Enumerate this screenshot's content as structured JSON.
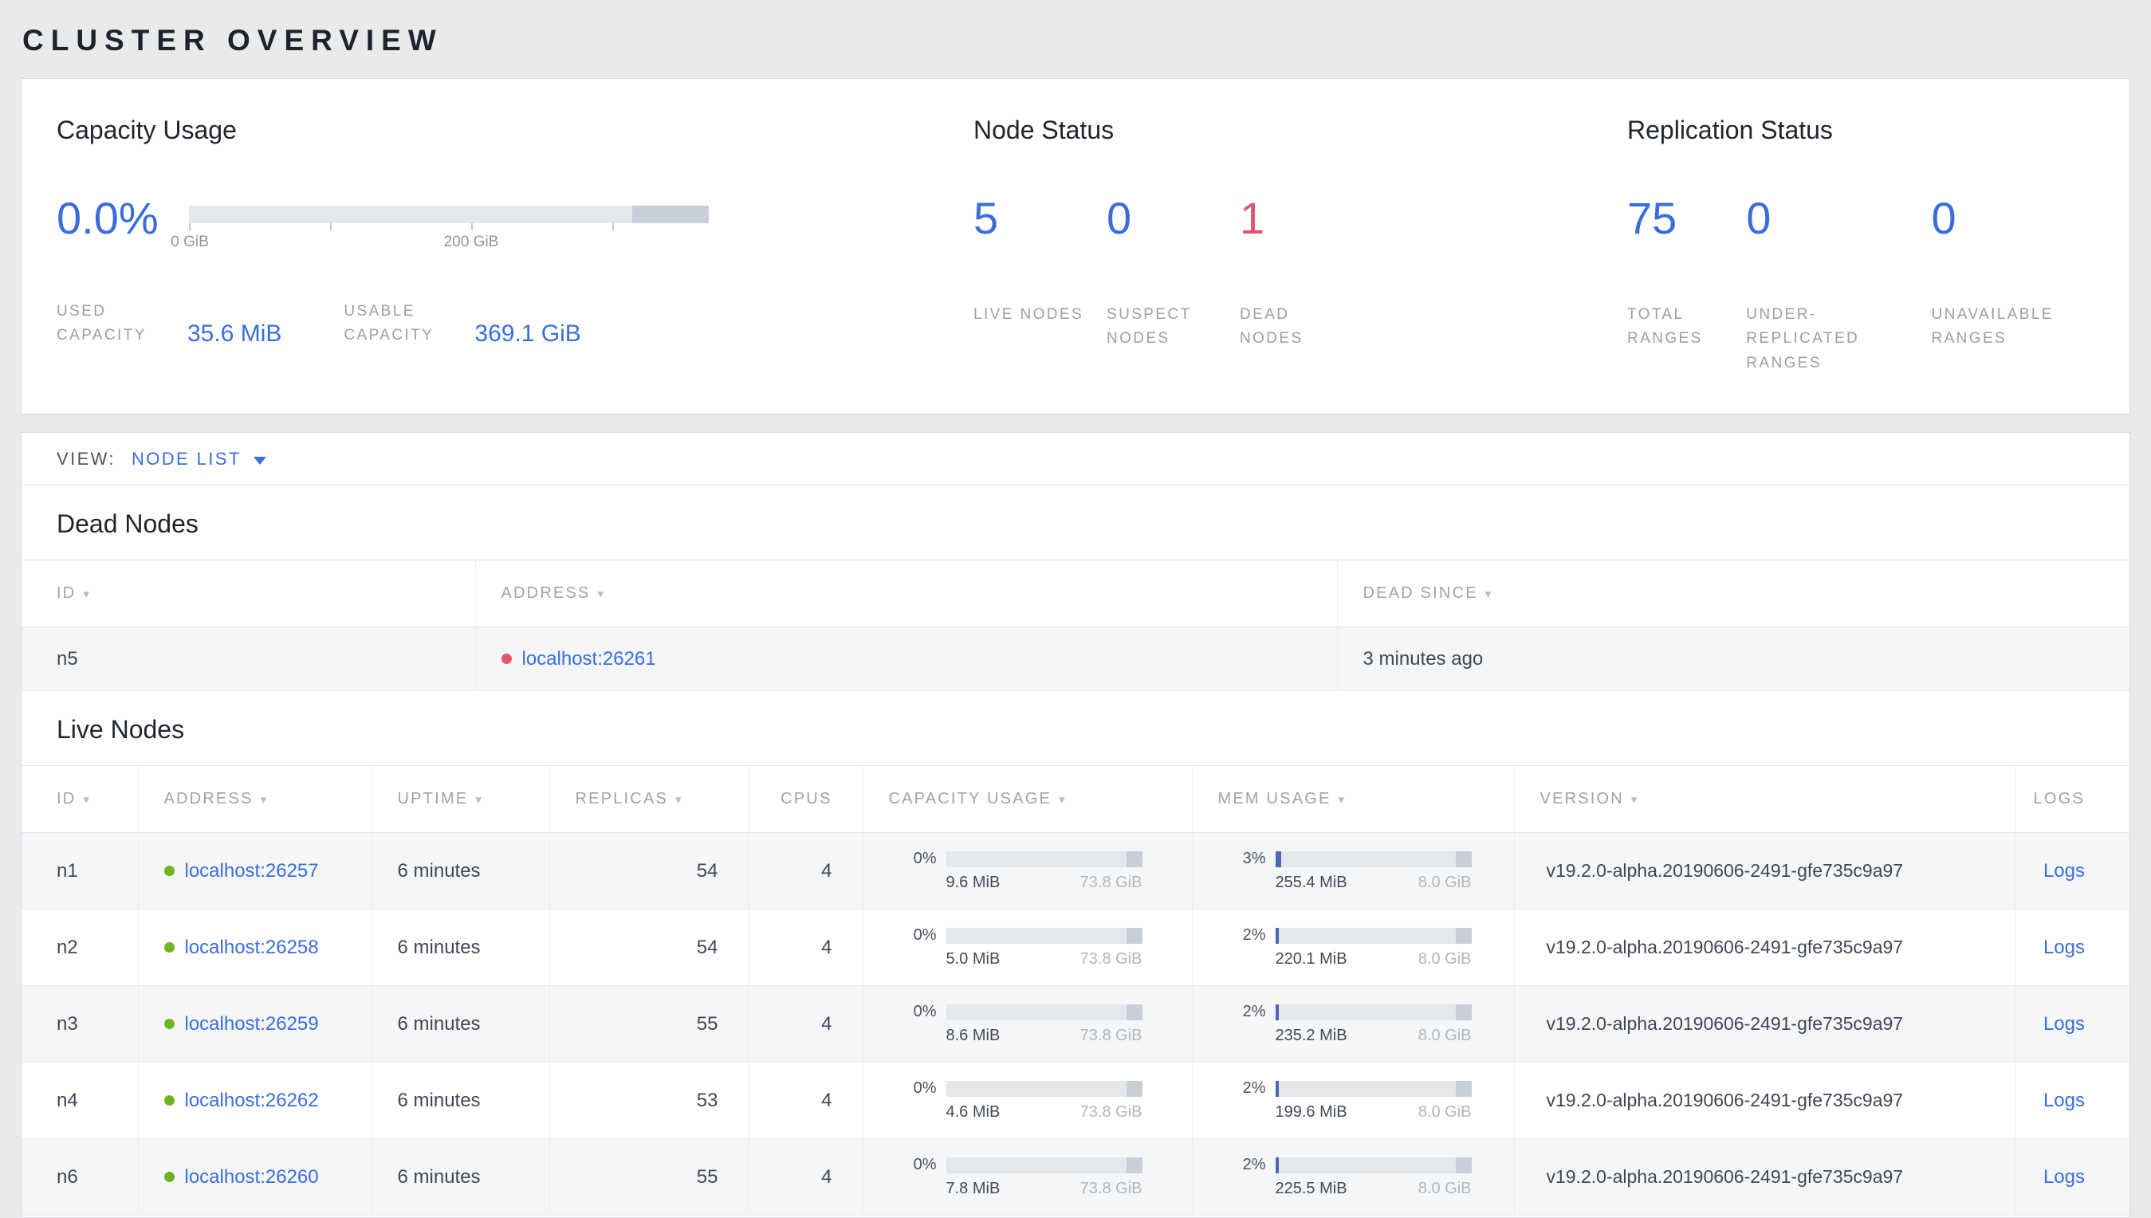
{
  "page_title": "CLUSTER OVERVIEW",
  "colors": {
    "accent_blue": "#3a6ddc",
    "dead_red": "#e2556d",
    "live_green": "#6fb421"
  },
  "summary": {
    "capacity": {
      "title": "Capacity Usage",
      "percent": "0.0%",
      "bar_fill_pct": 0,
      "tick_labels": [
        "0 GiB",
        "200 GiB"
      ],
      "used": {
        "label": "USED CAPACITY",
        "value": "35.6 MiB"
      },
      "usable": {
        "label": "USABLE CAPACITY",
        "value": "369.1 GiB"
      }
    },
    "node_status": {
      "title": "Node Status",
      "live": {
        "value": "5",
        "label": "LIVE NODES"
      },
      "suspect": {
        "value": "0",
        "label": "SUSPECT NODES"
      },
      "dead": {
        "value": "1",
        "label": "DEAD NODES"
      }
    },
    "replication": {
      "title": "Replication Status",
      "total": {
        "value": "75",
        "label": "TOTAL RANGES"
      },
      "under_replicated": {
        "value": "0",
        "label": "UNDER-REPLICATED RANGES"
      },
      "unavailable": {
        "value": "0",
        "label": "UNAVAILABLE RANGES"
      }
    }
  },
  "view": {
    "label": "VIEW:",
    "selected": "NODE LIST"
  },
  "dead_nodes": {
    "title": "Dead Nodes",
    "columns": [
      {
        "label": "ID",
        "sortable": true
      },
      {
        "label": "ADDRESS",
        "sortable": true
      },
      {
        "label": "DEAD SINCE",
        "sortable": true
      }
    ],
    "rows": [
      {
        "id": "n5",
        "address": "localhost:26261",
        "dead_since": "3 minutes ago"
      }
    ]
  },
  "live_nodes": {
    "title": "Live Nodes",
    "columns": [
      {
        "label": "ID",
        "sortable": true
      },
      {
        "label": "ADDRESS",
        "sortable": true
      },
      {
        "label": "UPTIME",
        "sortable": true
      },
      {
        "label": "REPLICAS",
        "sortable": true
      },
      {
        "label": "CPUS",
        "sortable": false
      },
      {
        "label": "CAPACITY USAGE",
        "sortable": true
      },
      {
        "label": "MEM USAGE",
        "sortable": true
      },
      {
        "label": "VERSION",
        "sortable": true
      },
      {
        "label": "LOGS",
        "sortable": false
      }
    ],
    "rows": [
      {
        "id": "n1",
        "address": "localhost:26257",
        "uptime": "6 minutes",
        "replicas": "54",
        "cpus": "4",
        "capacity": {
          "percent": "0%",
          "fill_pct": 0,
          "used": "9.6 MiB",
          "total": "73.8 GiB"
        },
        "memory": {
          "percent": "3%",
          "fill_pct": 3,
          "used": "255.4 MiB",
          "total": "8.0 GiB"
        },
        "version": "v19.2.0-alpha.20190606-2491-gfe735c9a97",
        "logs_label": "Logs"
      },
      {
        "id": "n2",
        "address": "localhost:26258",
        "uptime": "6 minutes",
        "replicas": "54",
        "cpus": "4",
        "capacity": {
          "percent": "0%",
          "fill_pct": 0,
          "used": "5.0 MiB",
          "total": "73.8 GiB"
        },
        "memory": {
          "percent": "2%",
          "fill_pct": 2,
          "used": "220.1 MiB",
          "total": "8.0 GiB"
        },
        "version": "v19.2.0-alpha.20190606-2491-gfe735c9a97",
        "logs_label": "Logs"
      },
      {
        "id": "n3",
        "address": "localhost:26259",
        "uptime": "6 minutes",
        "replicas": "55",
        "cpus": "4",
        "capacity": {
          "percent": "0%",
          "fill_pct": 0,
          "used": "8.6 MiB",
          "total": "73.8 GiB"
        },
        "memory": {
          "percent": "2%",
          "fill_pct": 2,
          "used": "235.2 MiB",
          "total": "8.0 GiB"
        },
        "version": "v19.2.0-alpha.20190606-2491-gfe735c9a97",
        "logs_label": "Logs"
      },
      {
        "id": "n4",
        "address": "localhost:26262",
        "uptime": "6 minutes",
        "replicas": "53",
        "cpus": "4",
        "capacity": {
          "percent": "0%",
          "fill_pct": 0,
          "used": "4.6 MiB",
          "total": "73.8 GiB"
        },
        "memory": {
          "percent": "2%",
          "fill_pct": 2,
          "used": "199.6 MiB",
          "total": "8.0 GiB"
        },
        "version": "v19.2.0-alpha.20190606-2491-gfe735c9a97",
        "logs_label": "Logs"
      },
      {
        "id": "n6",
        "address": "localhost:26260",
        "uptime": "6 minutes",
        "replicas": "55",
        "cpus": "4",
        "capacity": {
          "percent": "0%",
          "fill_pct": 0,
          "used": "7.8 MiB",
          "total": "73.8 GiB"
        },
        "memory": {
          "percent": "2%",
          "fill_pct": 2,
          "used": "225.5 MiB",
          "total": "8.0 GiB"
        },
        "version": "v19.2.0-alpha.20190606-2491-gfe735c9a97",
        "logs_label": "Logs"
      }
    ]
  }
}
